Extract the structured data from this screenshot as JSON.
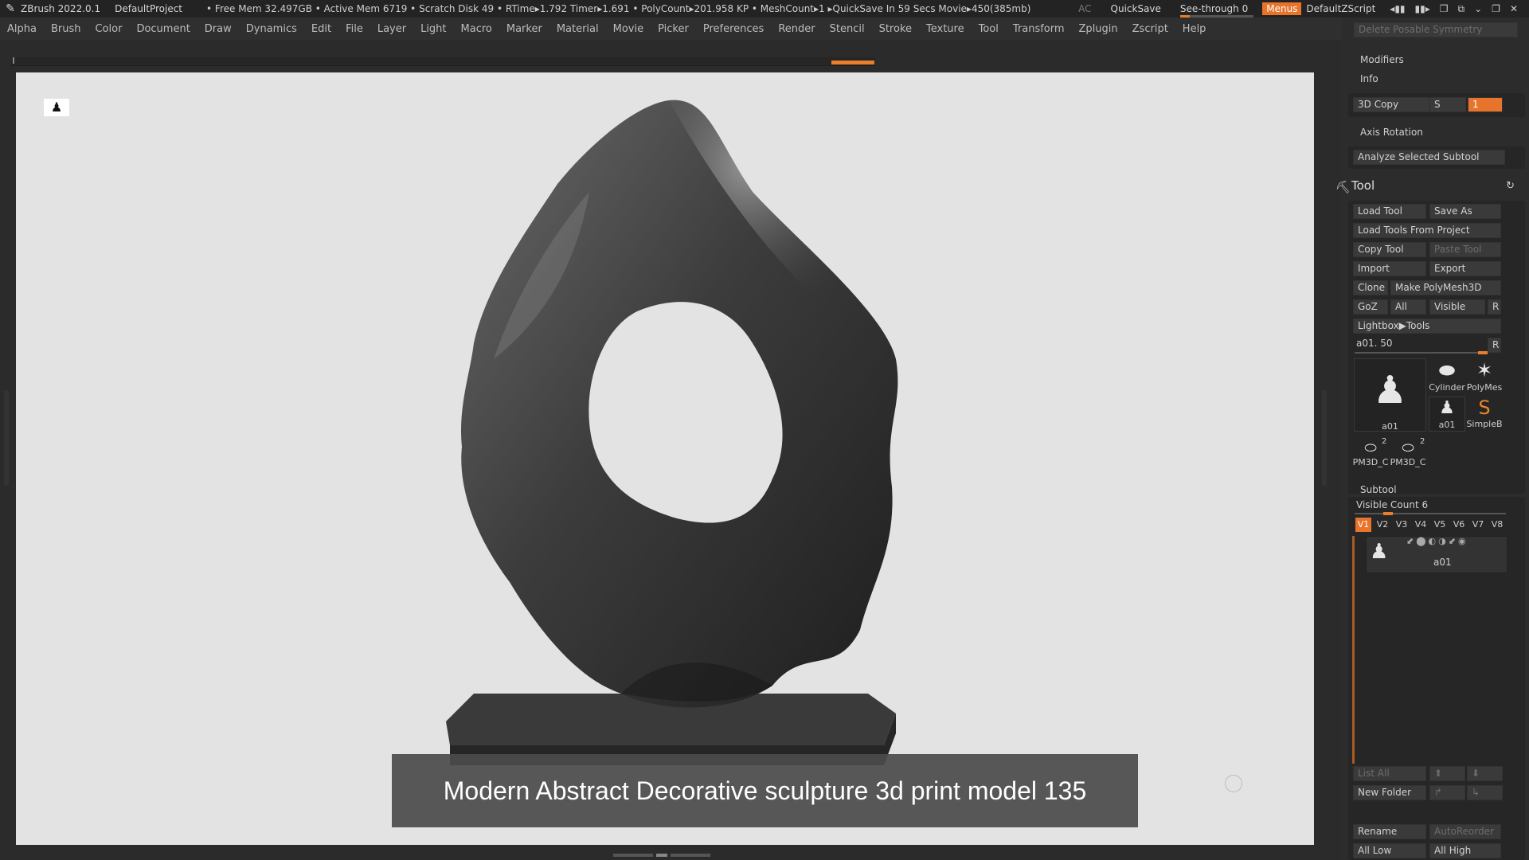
{
  "titlebar": {
    "app": "ZBrush 2022.0.1",
    "project": "DefaultProject",
    "stats": "• Free Mem 32.497GB • Active Mem 6719 • Scratch Disk 49 •  RTime▸1.792 Timer▸1.691 • PolyCount▸201.958 KP  • MeshCount▸1   ▸QuickSave In 59 Secs Movie▸450(385mb)",
    "ac": "AC",
    "quicksave": "QuickSave",
    "see_through": "See-through   0",
    "menus": "Menus",
    "default_zscript": "DefaultZScript"
  },
  "menubar": [
    "Alpha",
    "Brush",
    "Color",
    "Document",
    "Draw",
    "Dynamics",
    "Edit",
    "File",
    "Layer",
    "Light",
    "Macro",
    "Marker",
    "Material",
    "Movie",
    "Picker",
    "Preferences",
    "Render",
    "Stencil",
    "Stroke",
    "Texture",
    "Tool",
    "Transform",
    "Zplugin",
    "Zscript",
    "Help"
  ],
  "viewport": {
    "caption": "Modern Abstract Decorative sculpture 3d print model 135"
  },
  "right_panel": {
    "delete_posable_symmetry": "Delete Posable Symmetry",
    "modifiers": "Modifiers",
    "info": "Info",
    "copy3d": "3D Copy",
    "s_label": "S",
    "s_value": "1",
    "axis_rotation": "Axis Rotation",
    "analyze": "Analyze Selected Subtool",
    "tool_title": "Tool",
    "load_tool": "Load Tool",
    "save_as": "Save As",
    "load_tools_project": "Load Tools From Project",
    "copy_tool": "Copy Tool",
    "paste_tool": "Paste Tool",
    "import": "Import",
    "export": "Export",
    "clone": "Clone",
    "make_polymesh": "Make PolyMesh3D",
    "goz": "GoZ",
    "all": "All",
    "visible": "Visible",
    "r": "R",
    "lightbox_tools": "Lightbox▶Tools",
    "tool_slider": "a01. 50",
    "thumbs": {
      "a01_big": "a01",
      "cylinder": "Cylinder",
      "polymesh": "PolyMes",
      "a01_small": "a01",
      "simpleb": "SimpleB",
      "pm3d_1": "PM3D_C",
      "pm3d_2": "PM3D_C",
      "badge_1": "2",
      "badge_2": "2"
    },
    "subtool": "Subtool",
    "visible_count": "Visible Count 6",
    "vtabs": [
      "V1",
      "V2",
      "V3",
      "V4",
      "V5",
      "V6",
      "V7",
      "V8"
    ],
    "subtool_name": "a01",
    "list_all": "List All",
    "new_folder": "New Folder",
    "rename": "Rename",
    "auto_reorder": "AutoReorder",
    "all_low": "All Low",
    "all_high": "All High"
  },
  "colors": {
    "accent": "#e8742c",
    "viewport_bg": "#e3e3e3",
    "panel_bg": "#2c2c2c"
  }
}
